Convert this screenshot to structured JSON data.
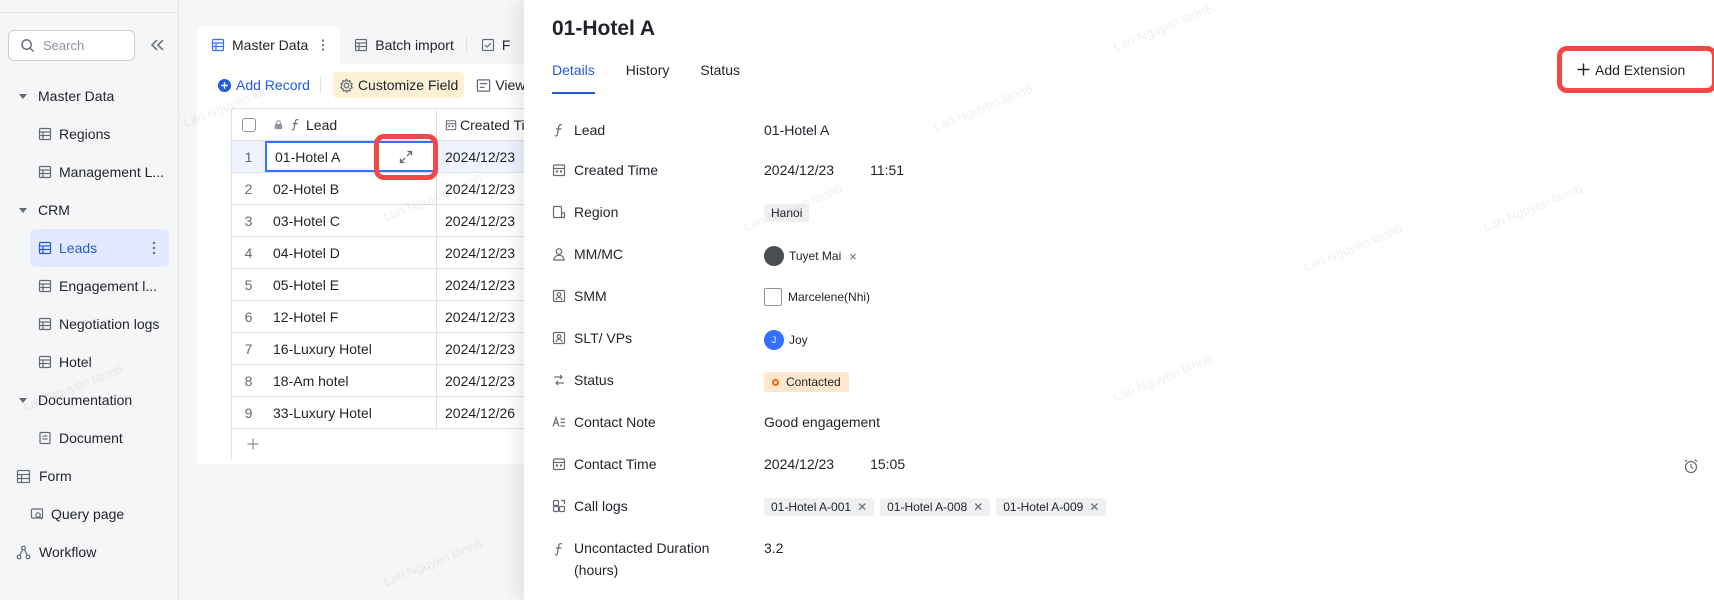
{
  "sidebar": {
    "search_placeholder": "Search",
    "items": [
      {
        "label": "Master Data"
      },
      {
        "label": "Regions"
      },
      {
        "label": "Management L..."
      },
      {
        "label": "CRM"
      },
      {
        "label": "Leads"
      },
      {
        "label": "Engagement l..."
      },
      {
        "label": "Negotiation logs"
      },
      {
        "label": "Hotel"
      },
      {
        "label": "Documentation"
      },
      {
        "label": "Document"
      },
      {
        "label": "Form"
      },
      {
        "label": "Query page"
      },
      {
        "label": "Workflow"
      }
    ]
  },
  "table_view": {
    "tabs": [
      {
        "label": "Master Data"
      },
      {
        "label": "Batch import"
      },
      {
        "label": "F"
      }
    ],
    "toolbar": {
      "add_record": "Add Record",
      "customize_field": "Customize Field",
      "view": "View"
    },
    "columns": {
      "lead": "Lead",
      "created_time": "Created Ti"
    },
    "rows": [
      {
        "num": "1",
        "lead": "01-Hotel A",
        "created": "2024/12/23"
      },
      {
        "num": "2",
        "lead": "02-Hotel B",
        "created": "2024/12/23"
      },
      {
        "num": "3",
        "lead": "03-Hotel C",
        "created": "2024/12/23"
      },
      {
        "num": "4",
        "lead": "04-Hotel D",
        "created": "2024/12/23"
      },
      {
        "num": "5",
        "lead": "05-Hotel E",
        "created": "2024/12/23"
      },
      {
        "num": "6",
        "lead": "12-Hotel F",
        "created": "2024/12/23"
      },
      {
        "num": "7",
        "lead": "16-Luxury Hotel",
        "created": "2024/12/23"
      },
      {
        "num": "8",
        "lead": "18-Am hotel",
        "created": "2024/12/23"
      },
      {
        "num": "9",
        "lead": "33-Luxury Hotel",
        "created": "2024/12/26"
      }
    ]
  },
  "detail": {
    "title": "01-Hotel A",
    "tabs": [
      {
        "label": "Details"
      },
      {
        "label": "History"
      },
      {
        "label": "Status"
      }
    ],
    "add_extension": "Add Extension",
    "fields": {
      "lead": {
        "label": "Lead",
        "value": "01-Hotel A"
      },
      "created_time": {
        "label": "Created Time",
        "date": "2024/12/23",
        "time": "11:51"
      },
      "region": {
        "label": "Region",
        "value": "Hanoi"
      },
      "mm_mc": {
        "label": "MM/MC",
        "value": "Tuyet Mai"
      },
      "smm": {
        "label": "SMM",
        "value": "Marcelene(Nhi)"
      },
      "slt_vps": {
        "label": "SLT/ VPs",
        "value": "Joy",
        "avatar_initial": "J"
      },
      "status": {
        "label": "Status",
        "value": "Contacted"
      },
      "contact_note": {
        "label": "Contact Note",
        "value": "Good engagement"
      },
      "contact_time": {
        "label": "Contact Time",
        "date": "2024/12/23",
        "time": "15:05"
      },
      "call_logs": {
        "label": "Call logs",
        "values": [
          "01-Hotel A-001",
          "01-Hotel A-008",
          "01-Hotel A-009"
        ]
      },
      "uncontacted": {
        "label": "Uncontacted Duration",
        "label_line2": "(hours)",
        "value": "3.2"
      }
    }
  },
  "watermark_text": "Lan Nguyen lann6",
  "colors": {
    "accent": "#245bdb",
    "highlight": "#f44847",
    "status_bg": "#fee7cd"
  }
}
